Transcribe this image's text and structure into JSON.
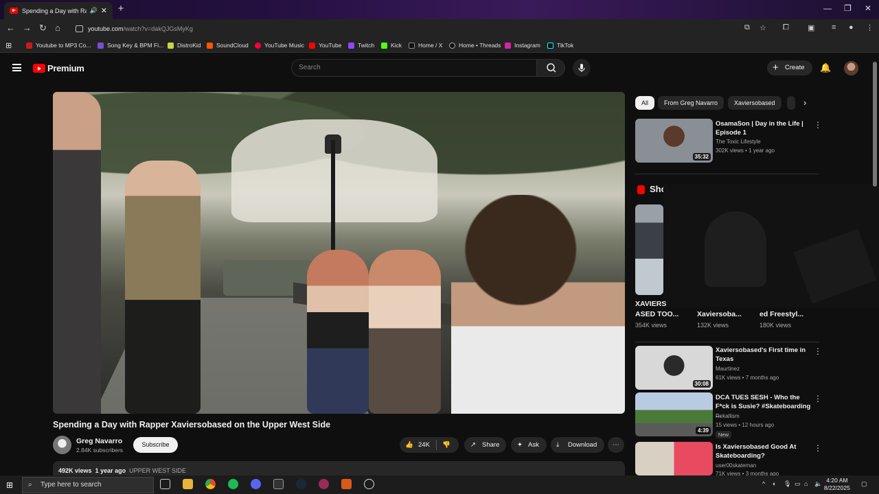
{
  "browser": {
    "tab_title": "Spending a Day with Rapper Xaviersobased - YouTube",
    "url_host": "youtube.com",
    "url_path": "/watch?v=dakQJGsMyKg",
    "bookmarks": [
      "Youtube to MP3 Co...",
      "Song Key & BPM Fi...",
      "DistroKid",
      "SoundCloud",
      "YouTube Music",
      "YouTube",
      "Twitch",
      "Kick",
      "Home / X",
      "Home • Threads",
      "Instagram",
      "TikTok"
    ]
  },
  "header": {
    "logo_text": "Premium",
    "search_placeholder": "Search",
    "create_label": "Create"
  },
  "video": {
    "title": "Spending a Day with Rapper Xaviersobased on the Upper West Side",
    "channel": "Greg Navarro",
    "subscribers": "2.84K subscribers",
    "subscribe_label": "Subscribe",
    "likes": "24K",
    "share_label": "Share",
    "ask_label": "Ask",
    "download_label": "Download",
    "views": "492K views",
    "age": "1 year ago",
    "tag": "UPPER WEST SIDE"
  },
  "chips": [
    "All",
    "From Greg Navarro",
    "Xaviersobased"
  ],
  "recommended": [
    {
      "title": "OsamaSon | Day in the Life | Episode 1",
      "channel": "The Toxic Lifestyle",
      "meta": "302K views • 1 year ago",
      "duration": "35:32"
    },
    {
      "title": "Xaviersobased's First time in Texas",
      "channel": "Maurtinez",
      "meta": "61K views • 7 months ago",
      "duration": "30:08"
    },
    {
      "title": "DCA TUES SESH - Who the F*ck is Susie? #Skateboarding ...",
      "channel": "Rekallism",
      "meta": "15 views • 12 hours ago",
      "duration": "4:39",
      "badge": "New"
    },
    {
      "title": "Is Xaviersobased Good At Skateboarding?",
      "channel": "user00skateman",
      "meta": "71K views • 3 months ago",
      "duration": ""
    }
  ],
  "shorts": {
    "label": "Sho",
    "items": [
      {
        "title1": "XAVIERS",
        "title2": "ASED TOO...",
        "views": "354K views"
      },
      {
        "title1": "Xaviersoba...",
        "title2": "",
        "views": "132K views"
      },
      {
        "title1": "ed Freestyl...",
        "title2": "",
        "views": "180K views"
      }
    ]
  },
  "taskbar": {
    "search_placeholder": "Type here to search",
    "time": "4:20 AM",
    "date": "8/22/2025"
  }
}
